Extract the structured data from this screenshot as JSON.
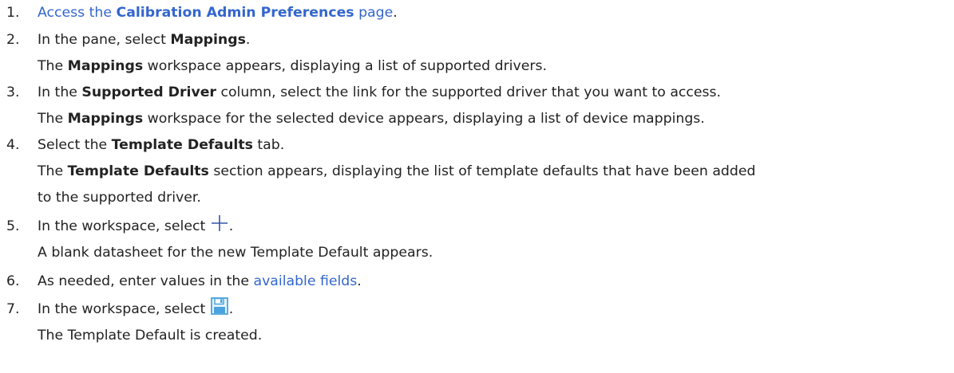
{
  "steps": [
    {
      "number": "1.",
      "pre": "Access the ",
      "link_bold": "Calibration Admin Preferences",
      "link_post": " page",
      "post": "."
    },
    {
      "number": "2.",
      "pre": "In the pane, select ",
      "bold": "Mappings",
      "post": ".",
      "result_bold": "Mappings",
      "result_rest": " workspace appears, displaying a list of supported drivers.",
      "result_pre": "The "
    },
    {
      "number": "3.",
      "pre": "In the ",
      "bold": "Supported Driver",
      "post": " column, select the link for the supported driver that you want to access.",
      "result_pre": "The ",
      "result_bold": "Mappings",
      "result_rest": " workspace for the selected device appears, displaying a list of device mappings."
    },
    {
      "number": "4.",
      "pre": "Select the ",
      "bold": "Template Defaults",
      "post": " tab.",
      "result_pre": "The ",
      "result_bold": "Template Defaults",
      "result_rest": " section appears, displaying the list of template defaults that have been added",
      "result_line2": "to the supported driver."
    },
    {
      "number": "5.",
      "pre": "In the workspace, select ",
      "icon": "plus-icon",
      "post": ".",
      "result": "A blank datasheet for the new Template Default appears."
    },
    {
      "number": "6.",
      "pre": "As needed, enter values in the ",
      "link": "available fields",
      "post": "."
    },
    {
      "number": "7.",
      "pre": "In the workspace, select ",
      "icon": "save-icon",
      "post": ".",
      "result": "The Template Default is created."
    }
  ],
  "colors": {
    "text": "#222222",
    "link": "#3366cc",
    "icon_plus": "#3355aa",
    "icon_save": "#4aa3df"
  }
}
